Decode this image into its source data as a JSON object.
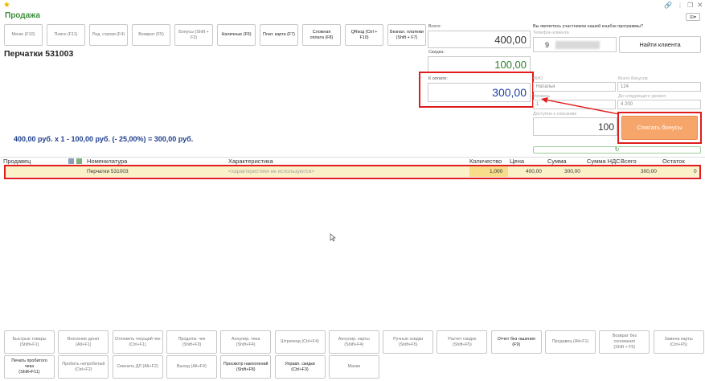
{
  "window": {
    "title": "Продажа",
    "star_icon": "star-icon",
    "controls": [
      "link-icon",
      "more-icon",
      "restore-icon",
      "close-icon"
    ],
    "more_menu": "Ещё"
  },
  "toolbar_top": [
    {
      "label": "Меню (F10)"
    },
    {
      "label": "Поиск (F11)"
    },
    {
      "label": "Ред. строки (F4)"
    },
    {
      "label": "Возврат (F5)"
    },
    {
      "label": "Бонусы (Shift + F3)"
    },
    {
      "label": "Наличные (F6)"
    },
    {
      "label": "Плат. карта (F7)"
    },
    {
      "label": "Сложная\nоплата (F8)"
    },
    {
      "label": "QRкод (Ctrl + F10)"
    },
    {
      "label": "Безнал. платежи\n(Shift + F7)"
    }
  ],
  "product": {
    "name": "Перчатки 531003",
    "formula": "400,00 руб. x 1  - 100,00 руб. (- 25,00%) = 300,00 руб."
  },
  "totals": {
    "total_label": "Всего:",
    "total_value": "400,00",
    "discount_label": "Скидка:",
    "discount_value": "100,00",
    "to_pay_label": "К оплате:",
    "to_pay_value": "300,00"
  },
  "loyalty": {
    "question": "Вы являетесь участником нашей кэшбэк программы?",
    "phone_label": "Телефон клиента",
    "phone_value": "9",
    "find_button": "Найти клиента",
    "fio_label": "ФИО",
    "fio_value": "Наталья",
    "bonus_label": "Всего бонусов",
    "bonus_value": "124",
    "level_label": "Уровень",
    "level_value": "1",
    "next_level_label": "До следующего уровня",
    "next_level_value": "4 200",
    "available_label": "Доступно к списанию",
    "available_value": "100",
    "writeoff_button": "Списать бонусы",
    "refresh_icon": "refresh-icon"
  },
  "table": {
    "columns": [
      "Продавец",
      "Номенклатура",
      "Характеристика",
      "Количество",
      "Цена",
      "Сумма",
      "Сумма НДС",
      "Всего",
      "Остаток"
    ],
    "rows": [
      {
        "seller": "",
        "item": "Перчатки 531003",
        "characteristic": "<характеристики не используются>",
        "qty": "1,000",
        "price": "400,00",
        "sum": "300,00",
        "vat": "",
        "total": "300,00",
        "rest": "0"
      }
    ]
  },
  "toolbar_bottom_row1": [
    {
      "label": "Быстрые товары\n(Shift+F1)"
    },
    {
      "label": "Внесение денег (Alt+F1)"
    },
    {
      "label": "Отложить текущий чек\n(Ctrl+F1)"
    },
    {
      "label": "Продолж. чек (Shift+F3)"
    },
    {
      "label": "Аннулир. чека (Shift+F4)"
    },
    {
      "label": "Штрихкод (Ctrl+F4)"
    },
    {
      "label": "Аннулир. карты (Shift+F4)"
    },
    {
      "label": "Ручные скидки (Shift+F5)"
    },
    {
      "label": "Расчет скидок (Shift+F5)"
    },
    {
      "label": "Отчет без гашения (F9)"
    },
    {
      "label": "Продавец (Alt+F1)"
    },
    {
      "label": "Возврат без основания\n(Shift + F5)"
    },
    {
      "label": "Замена карты (Ctrl+F5)"
    }
  ],
  "toolbar_bottom_row2": [
    {
      "label": "Печать пробитого чека\n(Shift+F11)"
    },
    {
      "label": "Пробить непробитый\n(Ctrl+F2)"
    },
    {
      "label": "Сменить ДЛ (Alt+F2)"
    },
    {
      "label": "Выход (Alt+F4)"
    },
    {
      "label": "Просмотр накоплений\n(Shift+F8)"
    },
    {
      "label": "Управл. скидки (Ctrl+F3)"
    },
    {
      "label": "Мазки"
    }
  ]
}
